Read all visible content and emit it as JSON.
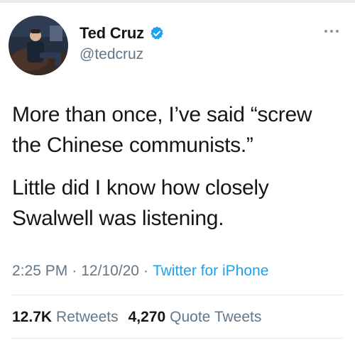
{
  "tweet": {
    "author": {
      "display_name": "Ted Cruz",
      "handle": "@tedcruz",
      "verified_icon": "verified-badge-icon"
    },
    "paragraphs": [
      "More than once, I’ve said “screw the Chinese communists.”",
      "Little did I know how closely Swalwell was listening."
    ],
    "time": "2:25 PM",
    "date": "12/10/20",
    "separator": "·",
    "source": "Twitter for iPhone",
    "stats": {
      "retweets_count": "12.7K",
      "retweets_label": "Retweets",
      "quote_count": "4,270",
      "quote_label": "Quote Tweets"
    }
  },
  "colors": {
    "text": "#14171a",
    "secondary": "#657786",
    "accent": "#1da1f2",
    "divider": "#e1e8ed"
  },
  "icons": {
    "more": "more-horizontal-icon"
  }
}
